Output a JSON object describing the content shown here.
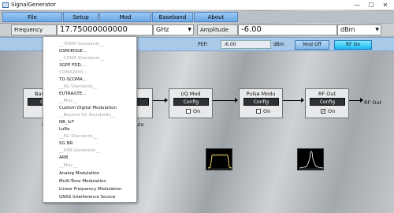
{
  "window": {
    "title": "SignalGenerator",
    "min": "—",
    "max": "☐",
    "close": "✕"
  },
  "menu": [
    "File",
    "Setup",
    "Mod",
    "Baseband",
    "About"
  ],
  "frequency": {
    "label": "Frequency",
    "value": "17.75000000000",
    "unit": "GHz"
  },
  "amplitude": {
    "label": "Amplitude",
    "value": "-6.00",
    "unit": "dBm"
  },
  "status": {
    "pep_label": "PEP:",
    "pep_value": "-6.00",
    "pep_unit": "dBm",
    "mod_off": "Mod Off",
    "rf_on": "RF On"
  },
  "blocks": {
    "baseband": {
      "title": "Bas",
      "config": "Co"
    },
    "hidden": {
      "config": "fig"
    },
    "iq": {
      "title": "I/Q Mod",
      "config": "Config",
      "on": "On"
    },
    "pulse": {
      "title": "Pulse Modu",
      "config": "Config",
      "on": "On"
    },
    "rfout": {
      "title": "RF Out",
      "config": "Config",
      "on": "On",
      "checked": true
    }
  },
  "rf_out_label": "RF Out",
  "fragments": {
    "left": "C",
    "right": "uto"
  },
  "dropdown_items": [
    {
      "label": "__TDMA Standards__",
      "header": true
    },
    {
      "label": "GSM/EDGE...",
      "header": false
    },
    {
      "label": "__CDMA Standards__",
      "header": true
    },
    {
      "label": "3GPP FDD...",
      "header": false
    },
    {
      "label": "CDMA2000...",
      "header": true
    },
    {
      "label": "TD-SCDMA...",
      "header": false
    },
    {
      "label": "__4G Standards__",
      "header": true
    },
    {
      "label": "EUTRA/LTE...",
      "header": false
    },
    {
      "label": "__Misc__",
      "header": true
    },
    {
      "label": "Custom Digital Modulation",
      "header": false
    },
    {
      "label": "__Beyond 5G Standards__",
      "header": true
    },
    {
      "label": "NB_IoT",
      "header": false
    },
    {
      "label": "LoRa",
      "header": false
    },
    {
      "label": "__5G Standards__",
      "header": true
    },
    {
      "label": "5G NR",
      "header": false
    },
    {
      "label": "__ARB Generator__",
      "header": true
    },
    {
      "label": "ARB",
      "header": false
    },
    {
      "label": "__Misc__",
      "header": true
    },
    {
      "label": "Analog Modulation",
      "header": false
    },
    {
      "label": "Multi-Tone Modulation",
      "header": false
    },
    {
      "label": "Linear Frequency Modulation",
      "header": false
    },
    {
      "label": "GNSS Interference Source",
      "header": false
    }
  ]
}
